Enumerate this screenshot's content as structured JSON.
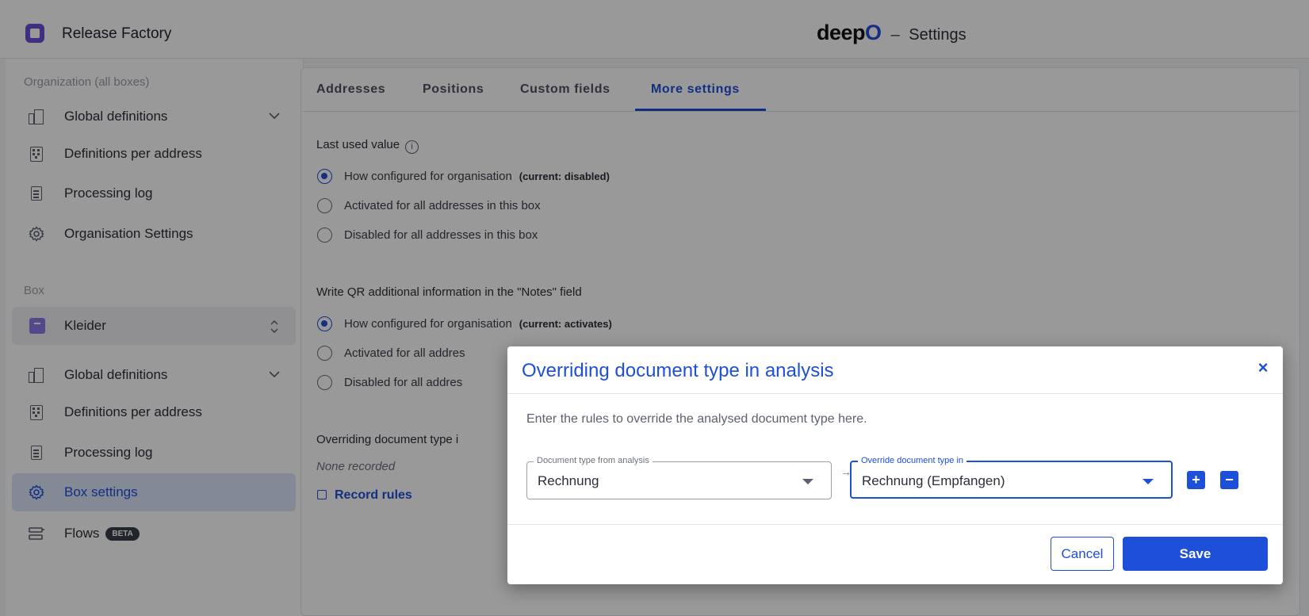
{
  "app": {
    "org_name": "Release Factory",
    "logo_deep": "deep",
    "logo_o": "O",
    "title_sep": "–",
    "page_title": "Settings"
  },
  "sidebar": {
    "org_section": "Organization (all boxes)",
    "org_items": [
      {
        "label": "Global definitions",
        "icon": "buildings-icon"
      },
      {
        "label": "Definitions per address",
        "icon": "building-icon"
      },
      {
        "label": "Processing log",
        "icon": "document-icon"
      },
      {
        "label": "Organisation Settings",
        "icon": "gear-icon"
      }
    ],
    "box_section": "Box",
    "box_selector": "Kleider",
    "box_items": [
      {
        "label": "Global definitions",
        "icon": "buildings-icon"
      },
      {
        "label": "Definitions per address",
        "icon": "building-icon"
      },
      {
        "label": "Processing log",
        "icon": "document-icon"
      },
      {
        "label": "Box settings",
        "icon": "gear-icon",
        "active": true
      },
      {
        "label": "Flows",
        "icon": "flows-icon",
        "badge": "BETA"
      }
    ]
  },
  "tabs": [
    {
      "label": "Addresses"
    },
    {
      "label": "Positions"
    },
    {
      "label": "Custom fields"
    },
    {
      "label": "More settings",
      "active": true
    }
  ],
  "settings": {
    "last_used": {
      "title": "Last used value",
      "options": [
        {
          "label": "How configured for organisation",
          "note": "(current: disabled)",
          "checked": true
        },
        {
          "label": "Activated for all addresses in this box"
        },
        {
          "label": "Disabled for all addresses in this box"
        }
      ]
    },
    "qr_notes": {
      "title": "Write QR additional information in the \"Notes\" field",
      "options": [
        {
          "label": "How configured for organisation",
          "note": "(current: activates)",
          "checked": true
        },
        {
          "label": "Activated for all addres"
        },
        {
          "label": "Disabled for all addres"
        }
      ]
    },
    "override": {
      "title": "Overriding document type i",
      "none_recorded": "None recorded",
      "record_rules": "Record rules"
    }
  },
  "modal": {
    "title": "Overriding document type in analysis",
    "description": "Enter the rules to override the analysed document type here.",
    "field_from": {
      "legend": "Document type from analysis",
      "value": "Rechnung"
    },
    "arrow": "→",
    "field_to": {
      "legend": "Override document type in",
      "value": "Rechnung (Empfangen)"
    },
    "add_label": "+",
    "remove_label": "−",
    "close_label": "×",
    "cancel_label": "Cancel",
    "save_label": "Save"
  },
  "colors": {
    "accent": "#1e4fd8",
    "box_swatch": "#8e79e6",
    "brand": "#6b4fd8"
  }
}
